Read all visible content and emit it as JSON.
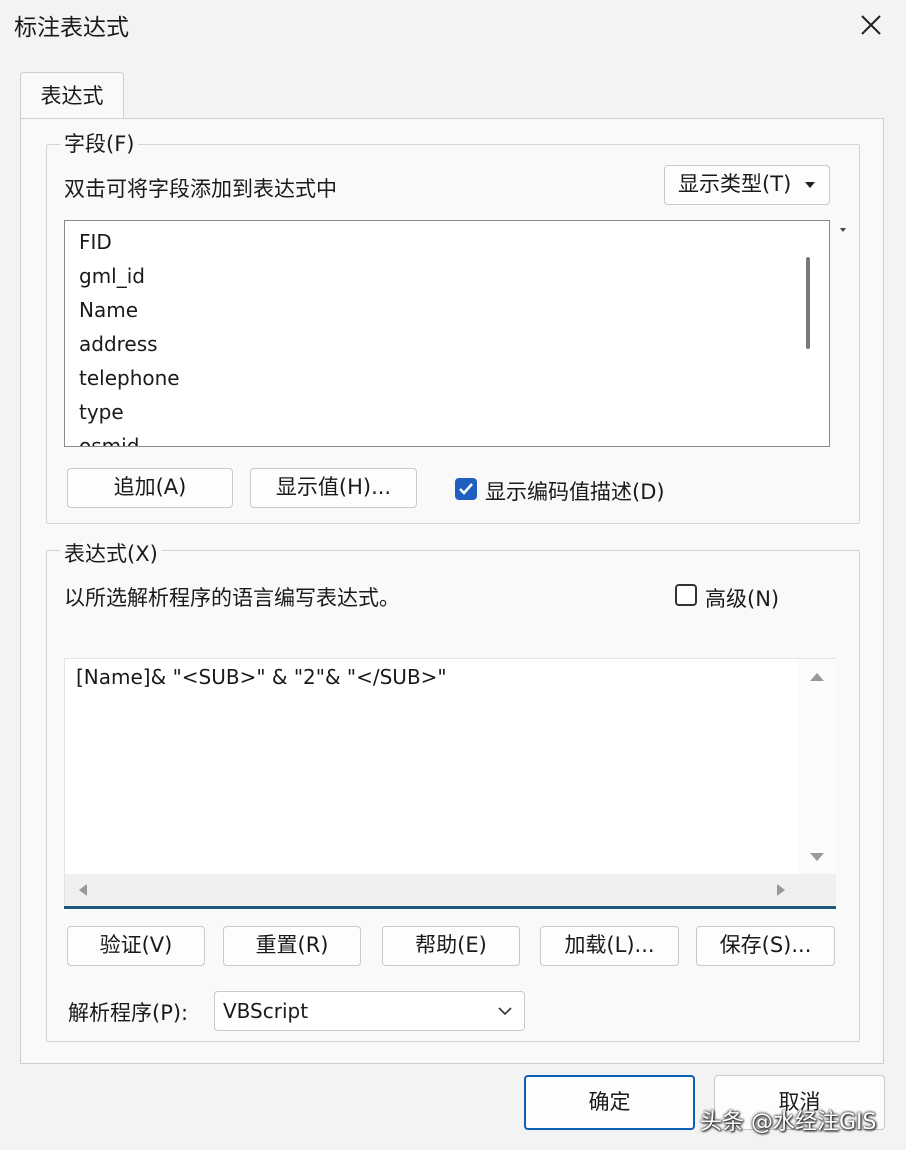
{
  "window": {
    "title": "标注表达式"
  },
  "tabs": [
    {
      "label": "表达式"
    }
  ],
  "fields": {
    "legend": "字段(F)",
    "instruction": "双击可将字段添加到表达式中",
    "display_type_button": "显示类型(T)",
    "items": [
      "FID",
      "gml_id",
      "Name",
      "address",
      "telephone",
      "type",
      "osmid"
    ],
    "add_button": "追加(A)",
    "show_values_button": "显示值(H)...",
    "show_coded_desc": {
      "label": "显示编码值描述(D)",
      "checked": true
    }
  },
  "expression": {
    "legend": "表达式(X)",
    "instruction": "以所选解析程序的语言编写表达式。",
    "advanced": {
      "label": "高级(N)",
      "checked": false
    },
    "value": "[Name]& \"<SUB>\" & \"2\"& \"</SUB>\"",
    "buttons": {
      "verify": "验证(V)",
      "reset": "重置(R)",
      "help": "帮助(E)",
      "load": "加载(L)...",
      "save": "保存(S)..."
    },
    "parser_label": "解析程序(P):",
    "parser_value": "VBScript"
  },
  "footer": {
    "ok": "确定",
    "cancel": "取消"
  },
  "watermark": "头条 @水经注GIS",
  "colors": {
    "accent": "#1f5fbf",
    "ok_border": "#0f5fb8",
    "editor_underline": "#1b5a7a"
  }
}
